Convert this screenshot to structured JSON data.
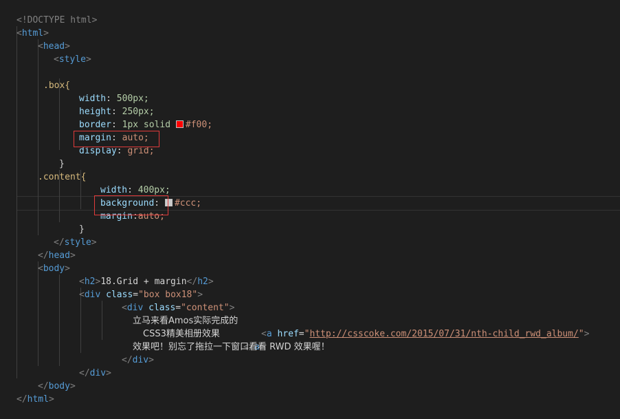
{
  "colors": {
    "background": "#1e1e1e",
    "tag": "#569cd6",
    "attribute": "#9cdcfe",
    "string": "#ce9178",
    "selector": "#d7ba7d",
    "number": "#b5cea8",
    "highlight_box": "#e23b3b",
    "swatch_red": "#ff0000",
    "swatch_gray": "#cccccc"
  },
  "code": {
    "doctype": "<!DOCTYPE html>",
    "html_open": "html",
    "head_open": "head",
    "style_open": "style",
    "box_selector": ".box{",
    "box_props": [
      {
        "prop": "width",
        "value": "500px;"
      },
      {
        "prop": "height",
        "value": "250px;"
      },
      {
        "prop": "border",
        "value": "1px solid",
        "color": "#f00;"
      },
      {
        "prop": "margin",
        "value": "auto;"
      },
      {
        "prop": "display",
        "value": "grid;"
      }
    ],
    "close_brace": "}",
    "content_selector": ".content{",
    "content_props": [
      {
        "prop": "width",
        "value": "400px;"
      },
      {
        "prop": "background",
        "color": "#ccc;"
      },
      {
        "prop": "margin",
        "value": "auto;"
      }
    ],
    "style_close": "style",
    "head_close": "head",
    "body_open": "body",
    "h2_tag": "h2",
    "h2_text": "18.Grid + margin",
    "div_tag": "div",
    "class_attr": "class",
    "box_class_value": "\"box box18\"",
    "content_class_value": "\"content\"",
    "text_line1": "立马来看Amos实际完成的",
    "a_tag": "a",
    "href_attr": "href",
    "href_value": "http://csscoke.com/2015/07/31/nth-child_rwd_album/",
    "text_line2": "CSS3精美相册效果",
    "a_close": "a",
    "text_line3": "效果吧！别忘了拖拉一下窗口看看 RWD 效果喔！",
    "div_close": "div",
    "body_close": "body",
    "html_close": "html"
  }
}
